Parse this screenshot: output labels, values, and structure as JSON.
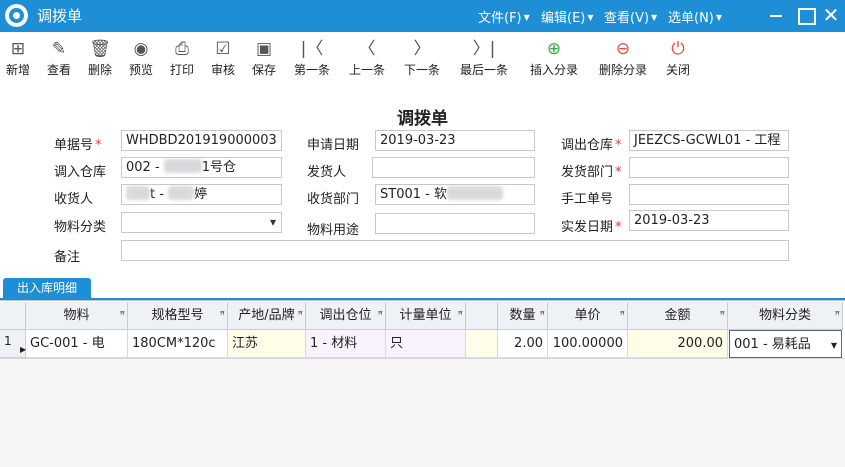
{
  "window": {
    "title": "调拨单",
    "menus": [
      {
        "label": "文件(F)"
      },
      {
        "label": "编辑(E)"
      },
      {
        "label": "查看(V)"
      },
      {
        "label": "选单(N)"
      }
    ],
    "close_glyph": "✕"
  },
  "toolbar": {
    "items": [
      {
        "name": "new",
        "label": "新增",
        "icon": "new-doc-icon",
        "glyph": "⊞"
      },
      {
        "name": "view",
        "label": "查看",
        "icon": "edit-icon",
        "glyph": "✎"
      },
      {
        "name": "delete",
        "label": "删除",
        "icon": "trash-icon",
        "glyph": "🗑"
      },
      {
        "name": "preview",
        "label": "预览",
        "icon": "eye-icon",
        "glyph": "◉"
      },
      {
        "name": "print",
        "label": "打印",
        "icon": "printer-icon",
        "glyph": "⎙"
      },
      {
        "name": "audit",
        "label": "审核",
        "icon": "check-square-icon",
        "glyph": "☑"
      },
      {
        "name": "save",
        "label": "保存",
        "icon": "floppy-icon",
        "glyph": "▣"
      },
      {
        "name": "first",
        "label": "第一条",
        "icon": "first-icon",
        "glyph": "|〈"
      },
      {
        "name": "prev",
        "label": "上一条",
        "icon": "prev-icon",
        "glyph": "〈"
      },
      {
        "name": "next",
        "label": "下一条",
        "icon": "next-icon",
        "glyph": "〉"
      },
      {
        "name": "last",
        "label": "最后一条",
        "icon": "last-icon",
        "glyph": "〉|"
      },
      {
        "name": "insert",
        "label": "插入分录",
        "icon": "plus-circle-icon",
        "glyph": "⊕"
      },
      {
        "name": "remove",
        "label": "删除分录",
        "icon": "minus-circle-icon",
        "glyph": "⊖"
      },
      {
        "name": "close",
        "label": "关闭",
        "icon": "power-icon",
        "glyph": "⏻"
      }
    ]
  },
  "form": {
    "title": "调拨单",
    "required_mark": "*",
    "fields": {
      "doc_no": {
        "label": "单据号",
        "value": "WHDBD201919000003"
      },
      "apply_date": {
        "label": "申请日期",
        "value": "2019-03-23"
      },
      "out_wh": {
        "label": "调出仓库",
        "value": "JEEZCS-GCWL01  - 工程"
      },
      "in_wh": {
        "label": "调入仓库",
        "value_prefix": "002 - ",
        "value_suffix": "1号仓"
      },
      "sender": {
        "label": "发货人",
        "value": ""
      },
      "send_dept": {
        "label": "发货部门",
        "value": ""
      },
      "receiver": {
        "label": "收货人",
        "value_prefix": "t - ",
        "value_suffix": "婷"
      },
      "recv_dept": {
        "label": "收货部门",
        "value_prefix": "ST001 - 软",
        "value_suffix": ""
      },
      "manual_no": {
        "label": "手工单号",
        "value": ""
      },
      "mat_class": {
        "label": "物料分类",
        "value": ""
      },
      "mat_use": {
        "label": "物料用途",
        "value": ""
      },
      "actual_date": {
        "label": "实发日期",
        "value": "2019-03-23"
      },
      "remark": {
        "label": "备注",
        "value": ""
      }
    }
  },
  "detail": {
    "tab_label": "出入库明细",
    "pin_glyph": "ꟸ",
    "columns": [
      {
        "key": "material",
        "label": "物料"
      },
      {
        "key": "spec",
        "label": "规格型号"
      },
      {
        "key": "origin",
        "label": "产地/品牌"
      },
      {
        "key": "location",
        "label": "调出仓位"
      },
      {
        "key": "unit",
        "label": "计量单位"
      },
      {
        "key": "qty",
        "label": "数量"
      },
      {
        "key": "price",
        "label": "单价"
      },
      {
        "key": "amount",
        "label": "金额"
      },
      {
        "key": "class",
        "label": "物料分类"
      }
    ],
    "rows": [
      {
        "row_no": "1",
        "material": "GC-001 - 电",
        "spec": "180CM*120c",
        "origin": "江苏",
        "location": "1 - 材料",
        "unit": "只",
        "qty": "2.00",
        "price": "100.00000",
        "amount": "200.00",
        "class": "001 - 易耗品"
      }
    ]
  }
}
